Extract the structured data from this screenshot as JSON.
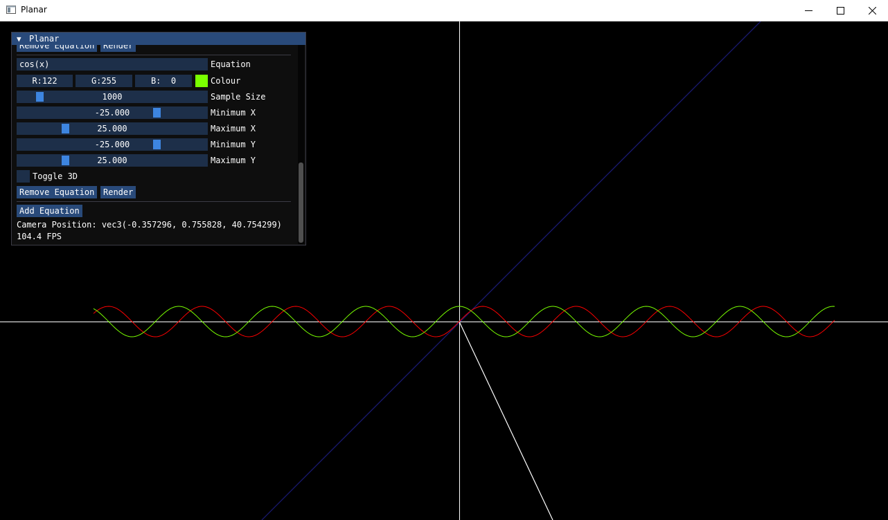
{
  "window": {
    "title": "Planar",
    "icon": "app-window-icon",
    "controls": [
      "minimize-icon",
      "maximize-icon",
      "close-icon"
    ]
  },
  "panel": {
    "title": "Planar",
    "top_buttons": {
      "remove": "Remove Equation",
      "render": "Render"
    },
    "equation": {
      "value": "cos(x)",
      "label": "Equation"
    },
    "colour": {
      "r": "R:122",
      "g": "G:255",
      "b": "B:  0",
      "label": "Colour",
      "swatch": "#7aff00"
    },
    "sample_size": {
      "value": "1000",
      "label": "Sample Size"
    },
    "min_x": {
      "value": "-25.000",
      "label": "Minimum X"
    },
    "max_x": {
      "value": "25.000",
      "label": "Maximum X"
    },
    "min_y": {
      "value": "-25.000",
      "label": "Minimum Y"
    },
    "max_y": {
      "value": "25.000",
      "label": "Maximum Y"
    },
    "toggle_3d": {
      "label": "Toggle 3D",
      "checked": false
    },
    "buttons": {
      "remove": "Remove Equation",
      "render": "Render",
      "add": "Add Equation"
    },
    "camera_position": "Camera Position: vec3(-0.357296, 0.755828, 40.754299)",
    "fps": "104.4 FPS"
  },
  "plot": {
    "curves": [
      {
        "equation": "sin(x)",
        "color": "#ff0000"
      },
      {
        "equation": "cos(x)",
        "color": "#7aff00"
      }
    ],
    "axis_colors": {
      "x": "#ffffff",
      "y": "#ffffff",
      "z": "#191970"
    }
  }
}
